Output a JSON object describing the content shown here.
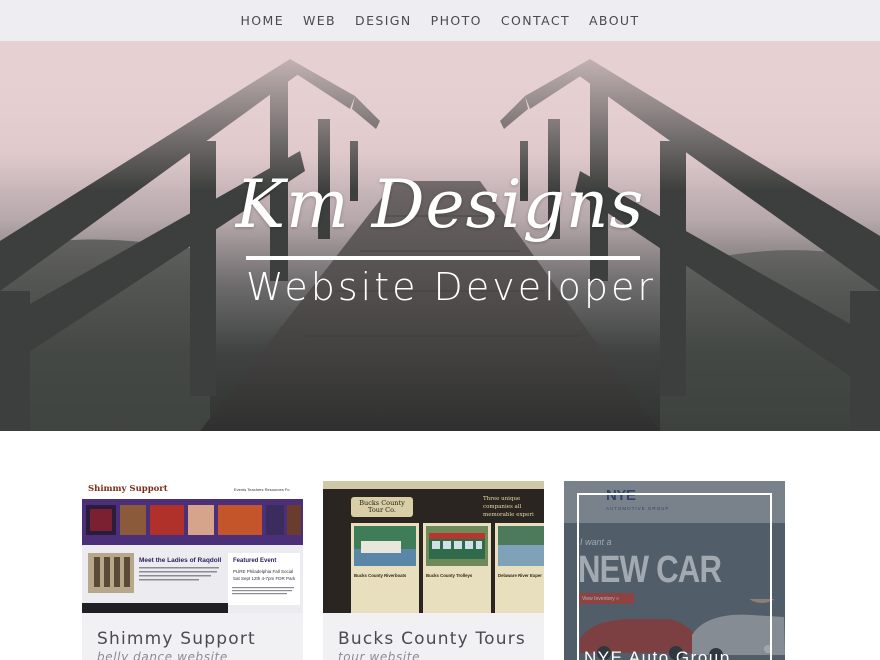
{
  "nav": {
    "items": [
      {
        "label": "HOME"
      },
      {
        "label": "WEB"
      },
      {
        "label": "DESIGN"
      },
      {
        "label": "PHOTO"
      },
      {
        "label": "CONTACT"
      },
      {
        "label": "ABOUT"
      }
    ]
  },
  "hero": {
    "title": "Km Designs",
    "subtitle": "Website Developer"
  },
  "cards": [
    {
      "title": "Shimmy Support",
      "subtitle": "belly dance website",
      "thumb": {
        "logo": "Shimmy Support",
        "menu": "Events    Teachers    Resources    Fo",
        "heading": "Meet the Ladies of Raqdoll",
        "event_title": "Featured Event",
        "event_text": "PURE Philadelphia Fall Social Sat Sept 12th 4-7pm FDR Park"
      }
    },
    {
      "title": "Bucks County Tours",
      "subtitle": "tour website",
      "thumb": {
        "logo": "Bucks County Tour Co.",
        "tagline": "Three unique companies all memorable experi",
        "panels": [
          "Bucks County Riverboats",
          "Bucks County Trolleys",
          "Delaware River Exper"
        ]
      }
    },
    {
      "title": "NYE Auto Group",
      "subtitle": "",
      "thumb": {
        "logo": "NYE",
        "logo_sub": "AUTOMOTIVE GROUP",
        "want": "I want a",
        "headline": "NEW CAR",
        "button": "View Inventory »"
      }
    }
  ],
  "colors": {
    "nav_bg": "#eeedf2",
    "nav_text": "#4a4a52",
    "card_bg": "#f1f1f3",
    "card_title": "#4a4a52",
    "card_sub": "#8b8b92"
  }
}
